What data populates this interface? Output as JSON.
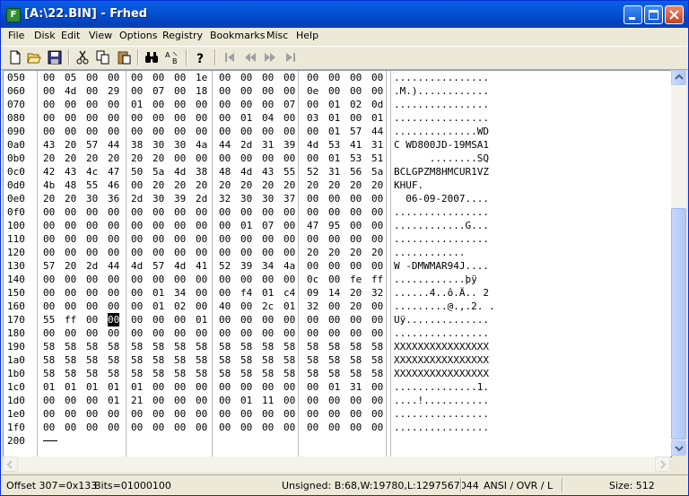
{
  "window": {
    "title": "[A:\\22.BIN] - Frhed",
    "app_icon": "F"
  },
  "menu": [
    "File",
    "Disk",
    "Edit",
    "View",
    "Options",
    "Registry",
    "Bookmarks",
    "Misc",
    "Help"
  ],
  "toolbar": [
    "new-file-icon",
    "open-folder-icon",
    "save-disk-icon",
    "cut-scissors-icon",
    "copy-icon",
    "paste-icon",
    "find-binoculars-icon",
    "replace-icon",
    "help-question-icon",
    "first-bookmark-icon",
    "prev-bookmark-icon",
    "next-bookmark-icon",
    "last-bookmark-icon"
  ],
  "hex": {
    "selected_row": 18,
    "selected_col": 3,
    "rows": [
      {
        "off": "050",
        "bytes": [
          "00",
          "05",
          "00",
          "00",
          "00",
          "00",
          "00",
          "1e",
          "00",
          "00",
          "00",
          "00",
          "00",
          "00",
          "00",
          "00"
        ],
        "ascii": "................"
      },
      {
        "off": "060",
        "bytes": [
          "00",
          "4d",
          "00",
          "29",
          "00",
          "07",
          "00",
          "18",
          "00",
          "00",
          "00",
          "00",
          "0e",
          "00",
          "00",
          "00"
        ],
        "ascii": ".M.)............"
      },
      {
        "off": "070",
        "bytes": [
          "00",
          "00",
          "00",
          "00",
          "01",
          "00",
          "00",
          "00",
          "00",
          "00",
          "00",
          "07",
          "00",
          "01",
          "02",
          "0d"
        ],
        "ascii": "................"
      },
      {
        "off": "080",
        "bytes": [
          "00",
          "00",
          "00",
          "00",
          "00",
          "00",
          "00",
          "00",
          "00",
          "01",
          "04",
          "00",
          "03",
          "01",
          "00",
          "01"
        ],
        "ascii": "................"
      },
      {
        "off": "090",
        "bytes": [
          "00",
          "00",
          "00",
          "00",
          "00",
          "00",
          "00",
          "00",
          "00",
          "00",
          "00",
          "00",
          "00",
          "01",
          "57",
          "44"
        ],
        "ascii": "..............WD"
      },
      {
        "off": "0a0",
        "bytes": [
          "43",
          "20",
          "57",
          "44",
          "38",
          "30",
          "30",
          "4a",
          "44",
          "2d",
          "31",
          "39",
          "4d",
          "53",
          "41",
          "31"
        ],
        "ascii": "C WD800JD-19MSA1"
      },
      {
        "off": "0b0",
        "bytes": [
          "20",
          "20",
          "20",
          "20",
          "20",
          "20",
          "00",
          "00",
          "00",
          "00",
          "00",
          "00",
          "00",
          "01",
          "53",
          "51"
        ],
        "ascii": "      ........SQ"
      },
      {
        "off": "0c0",
        "bytes": [
          "42",
          "43",
          "4c",
          "47",
          "50",
          "5a",
          "4d",
          "38",
          "48",
          "4d",
          "43",
          "55",
          "52",
          "31",
          "56",
          "5a"
        ],
        "ascii": "BCLGPZM8HMCUR1VZ"
      },
      {
        "off": "0d0",
        "bytes": [
          "4b",
          "48",
          "55",
          "46",
          "00",
          "20",
          "20",
          "20",
          "20",
          "20",
          "20",
          "20",
          "20",
          "20",
          "20",
          "20"
        ],
        "ascii": "KHUF.           "
      },
      {
        "off": "0e0",
        "bytes": [
          "20",
          "20",
          "30",
          "36",
          "2d",
          "30",
          "39",
          "2d",
          "32",
          "30",
          "30",
          "37",
          "00",
          "00",
          "00",
          "00"
        ],
        "ascii": "  06-09-2007...."
      },
      {
        "off": "0f0",
        "bytes": [
          "00",
          "00",
          "00",
          "00",
          "00",
          "00",
          "00",
          "00",
          "00",
          "00",
          "00",
          "00",
          "00",
          "00",
          "00",
          "00"
        ],
        "ascii": "................"
      },
      {
        "off": "100",
        "bytes": [
          "00",
          "00",
          "00",
          "00",
          "00",
          "00",
          "00",
          "00",
          "00",
          "01",
          "07",
          "00",
          "47",
          "95",
          "00",
          "00"
        ],
        "ascii": "............G..."
      },
      {
        "off": "110",
        "bytes": [
          "00",
          "00",
          "00",
          "00",
          "00",
          "00",
          "00",
          "00",
          "00",
          "00",
          "00",
          "00",
          "00",
          "00",
          "00",
          "00"
        ],
        "ascii": "................"
      },
      {
        "off": "120",
        "bytes": [
          "00",
          "00",
          "00",
          "00",
          "00",
          "00",
          "00",
          "00",
          "00",
          "00",
          "00",
          "00",
          "20",
          "20",
          "20",
          "20"
        ],
        "ascii": "............    "
      },
      {
        "off": "130",
        "bytes": [
          "57",
          "20",
          "2d",
          "44",
          "4d",
          "57",
          "4d",
          "41",
          "52",
          "39",
          "34",
          "4a",
          "00",
          "00",
          "00",
          "00"
        ],
        "ascii": "W -DMWMAR94J...."
      },
      {
        "off": "140",
        "bytes": [
          "00",
          "00",
          "00",
          "00",
          "00",
          "00",
          "00",
          "00",
          "00",
          "00",
          "00",
          "00",
          "0c",
          "00",
          "fe",
          "ff"
        ],
        "ascii": "............þÿ"
      },
      {
        "off": "150",
        "bytes": [
          "00",
          "00",
          "00",
          "00",
          "00",
          "01",
          "34",
          "00",
          "00",
          "f4",
          "01",
          "c4",
          "09",
          "14",
          "20",
          "32"
        ],
        "ascii": "......4..ô.Ä.. 2"
      },
      {
        "off": "160",
        "bytes": [
          "00",
          "00",
          "00",
          "00",
          "00",
          "01",
          "02",
          "00",
          "40",
          "00",
          "2c",
          "01",
          "32",
          "00",
          "20",
          "00"
        ],
        "ascii": ".........@.,.2. ."
      },
      {
        "off": "170",
        "bytes": [
          "55",
          "ff",
          "00",
          "00",
          "00",
          "00",
          "00",
          "01",
          "00",
          "00",
          "00",
          "00",
          "00",
          "00",
          "00",
          "00"
        ],
        "ascii": "Uÿ.............."
      },
      {
        "off": "180",
        "bytes": [
          "00",
          "00",
          "00",
          "00",
          "00",
          "00",
          "00",
          "00",
          "00",
          "00",
          "00",
          "00",
          "00",
          "00",
          "00",
          "00"
        ],
        "ascii": "................"
      },
      {
        "off": "190",
        "bytes": [
          "58",
          "58",
          "58",
          "58",
          "58",
          "58",
          "58",
          "58",
          "58",
          "58",
          "58",
          "58",
          "58",
          "58",
          "58",
          "58"
        ],
        "ascii": "XXXXXXXXXXXXXXXX"
      },
      {
        "off": "1a0",
        "bytes": [
          "58",
          "58",
          "58",
          "58",
          "58",
          "58",
          "58",
          "58",
          "58",
          "58",
          "58",
          "58",
          "58",
          "58",
          "58",
          "58"
        ],
        "ascii": "XXXXXXXXXXXXXXXX"
      },
      {
        "off": "1b0",
        "bytes": [
          "58",
          "58",
          "58",
          "58",
          "58",
          "58",
          "58",
          "58",
          "58",
          "58",
          "58",
          "58",
          "58",
          "58",
          "58",
          "58"
        ],
        "ascii": "XXXXXXXXXXXXXXXX"
      },
      {
        "off": "1c0",
        "bytes": [
          "01",
          "01",
          "01",
          "01",
          "01",
          "00",
          "00",
          "00",
          "00",
          "00",
          "00",
          "00",
          "00",
          "01",
          "31",
          "00"
        ],
        "ascii": "..............1."
      },
      {
        "off": "1d0",
        "bytes": [
          "00",
          "00",
          "00",
          "01",
          "21",
          "00",
          "00",
          "00",
          "00",
          "01",
          "11",
          "00",
          "00",
          "00",
          "00",
          "00"
        ],
        "ascii": "....!..........."
      },
      {
        "off": "1e0",
        "bytes": [
          "00",
          "00",
          "00",
          "00",
          "00",
          "00",
          "00",
          "00",
          "00",
          "00",
          "00",
          "00",
          "00",
          "00",
          "00",
          "00"
        ],
        "ascii": "................"
      },
      {
        "off": "1f0",
        "bytes": [
          "00",
          "00",
          "00",
          "00",
          "00",
          "00",
          "00",
          "00",
          "00",
          "00",
          "00",
          "00",
          "00",
          "00",
          "00",
          "00"
        ],
        "ascii": "................"
      },
      {
        "off": "200",
        "bytes": [],
        "ascii": ""
      }
    ]
  },
  "status": {
    "offset": "Offset 307=0x133",
    "bits": "Bits=01000100",
    "unsigned": "Unsigned: B:68,W:19780,L:1297567044",
    "mode": "ANSI / OVR / L",
    "size": "Size: 512"
  }
}
